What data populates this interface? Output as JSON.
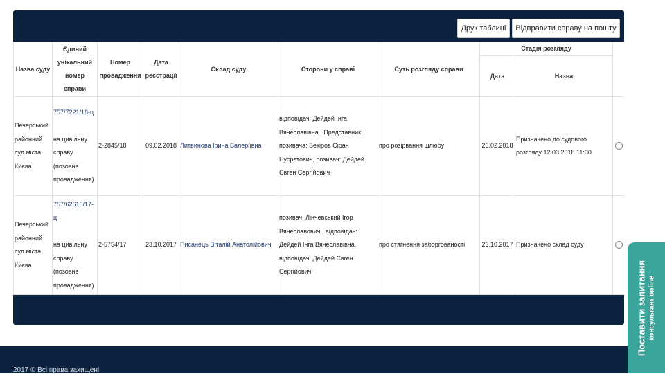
{
  "toolbar": {
    "print_label": "Друк таблиці",
    "mail_label": "Відправити справу на пошту"
  },
  "table": {
    "headers": {
      "court": "Назва суду",
      "case_number": "Єдиний унікальний номер справи",
      "proceeding": "Номер провадження",
      "reg_date": "Дата реєстрації",
      "composition": "Склад суду",
      "parties": "Сторони у справі",
      "essence": "Суть розгляду справи",
      "stage": "Стадія розгляду",
      "stage_date": "Дата",
      "stage_name": "Назва"
    },
    "rows": [
      {
        "court": "Печерський районний суд міста Києва",
        "case_link": "757/7221/18-ц",
        "case_type": "на цивільну справу (позовне провадження)",
        "proceeding": "2-2845/18",
        "reg_date": "09.02.2018",
        "composition": "Литвинова Ірина Валеріївна",
        "parties": "відповідач: Дейдей Інга Вячеславівна , Представник позивача: Бекіров Сіран Нусрєтович, позивач: Дейдей Євген Сергійович",
        "essence": "про розірвання шлюбу",
        "stage_date": "26.02.2018",
        "stage_name": "Призначено до судового розгляду 12.03.2018 11:30"
      },
      {
        "court": "Печерський районний суд міста Києва",
        "case_link": "757/62615/17-ц",
        "case_type": "на цивільну справу (позовне провадження)",
        "proceeding": "2-5754/17",
        "reg_date": "23.10.2017",
        "composition": "Писанець Віталій Анатолійович",
        "parties": "позивач: Лінчевський Ігор Вячеславович , відповідач: Дейдей Інга Вячеславівна, відповідач: Дейдей Євген Сергійович",
        "essence": "про стягнення заборгованості",
        "stage_date": "23.10.2017",
        "stage_name": "Призначено склад суду"
      }
    ]
  },
  "footer": {
    "copyright": "2017 © Всі права захищені"
  },
  "consult_widget": {
    "title": "Поставити запитання",
    "subtitle": "консультант online"
  },
  "colors": {
    "navy": "#0c2340",
    "teal": "#3aa59a",
    "link": "#1f3a70"
  }
}
